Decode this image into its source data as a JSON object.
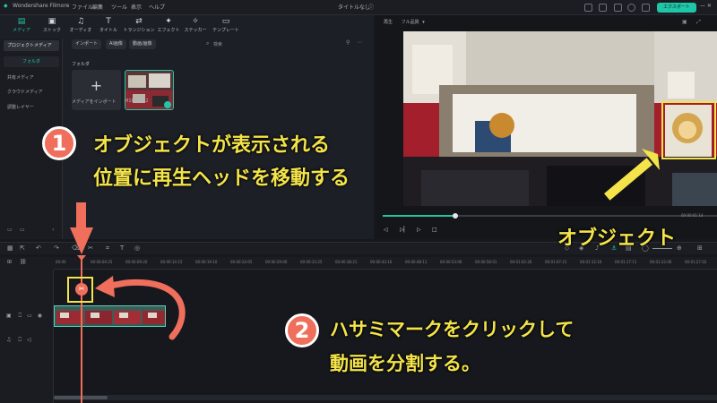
{
  "app": {
    "name": "Wondershare Filmore",
    "project_title": "タイトルなし"
  },
  "menu": [
    "ファイル",
    "編集",
    "ツール",
    "表示",
    "ヘルプ"
  ],
  "export_label": "エクスポート",
  "media_tabs": [
    {
      "label": "メディア",
      "icon": "media-icon"
    },
    {
      "label": "ストック",
      "icon": "stock-icon"
    },
    {
      "label": "オーディオ",
      "icon": "music-icon"
    },
    {
      "label": "タイトル",
      "icon": "title-icon"
    },
    {
      "label": "トランジション",
      "icon": "transition-icon"
    },
    {
      "label": "エフェクト",
      "icon": "effect-icon"
    },
    {
      "label": "ステッカー",
      "icon": "sticker-icon"
    },
    {
      "label": "テンプレート",
      "icon": "template-icon"
    }
  ],
  "sidebar": {
    "items": [
      {
        "label": "プロジェクトメディア"
      },
      {
        "label": "フォルダ"
      },
      {
        "label": "共有メディア"
      },
      {
        "label": "クラウドメディア"
      },
      {
        "label": "調整レイヤー"
      }
    ]
  },
  "media_toolbar": {
    "import": "インポート",
    "ai_image": "AI画像",
    "filter": "動画/画像",
    "search": "検索"
  },
  "media": {
    "folder": "フォルダ",
    "import_label": "メディアをインポート",
    "clip_name": "M1666062"
  },
  "player": {
    "mode": "再生",
    "quality": "フル品質",
    "timecode": "00:00:01:14"
  },
  "timeline": {
    "ticks": [
      "00:00",
      "00:00:04:25",
      "00:00:09:20",
      "00:00:14:15",
      "00:00:19:10",
      "00:00:24:05",
      "00:00:29:00",
      "00:00:33:25",
      "00:00:38:21",
      "00:00:43:16",
      "00:00:48:11",
      "00:00:53:06",
      "00:00:58:01",
      "00:01:02:26",
      "00:01:07:21",
      "00:01:12:16",
      "00:01:17:11",
      "00:01:22:06",
      "00:01:27:02",
      "00:01:31:27"
    ]
  },
  "annotations": {
    "step1_number": "1",
    "step1_line1": "オブジェクトが表示される",
    "step1_line2": "位置に再生ヘッドを移動する",
    "step2_number": "2",
    "step2_line1": "ハサミマークをクリックして",
    "step2_line2": "動画を分割する。",
    "object_label": "オブジェクト"
  },
  "colors": {
    "accent": "#1fc6a8",
    "annotation_yellow": "#f4e44a",
    "annotation_red": "#ef6f5c"
  }
}
